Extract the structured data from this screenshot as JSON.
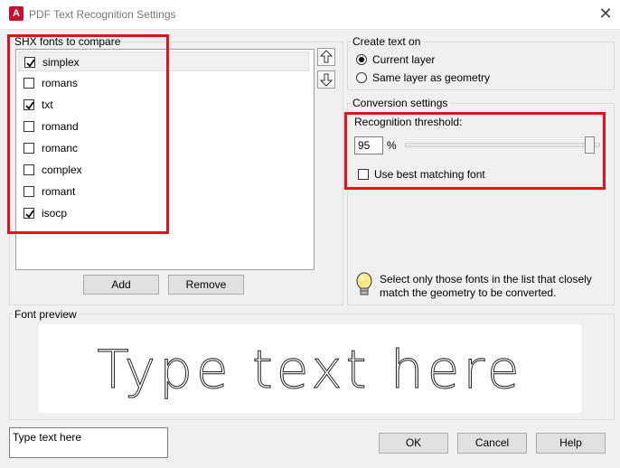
{
  "window": {
    "title": "PDF Text Recognition Settings",
    "app_icon_letter": "A",
    "close_glyph": "✕"
  },
  "shx_group": {
    "label": "SHX fonts to compare",
    "fonts": [
      {
        "name": "simplex",
        "checked": true
      },
      {
        "name": "romans",
        "checked": false
      },
      {
        "name": "txt",
        "checked": true
      },
      {
        "name": "romand",
        "checked": false
      },
      {
        "name": "romanc",
        "checked": false
      },
      {
        "name": "complex",
        "checked": false
      },
      {
        "name": "romant",
        "checked": false
      },
      {
        "name": "isocp",
        "checked": true
      }
    ],
    "add_label": "Add",
    "remove_label": "Remove"
  },
  "create_text": {
    "label": "Create text on",
    "options": [
      "Current layer",
      "Same layer as geometry"
    ],
    "selected": "Current layer"
  },
  "conversion": {
    "label": "Conversion settings",
    "threshold_label": "Recognition threshold:",
    "threshold_value": "95",
    "threshold_unit": "%",
    "best_match_label": "Use best matching font",
    "best_match_checked": false,
    "tip_line1": "Select only those fonts in the list that closely",
    "tip_line2": "match the geometry to be converted."
  },
  "preview": {
    "label": "Font preview",
    "sample_text": "Type text here"
  },
  "footer": {
    "preview_input_value": "Type text here",
    "ok_label": "OK",
    "cancel_label": "Cancel",
    "help_label": "Help"
  },
  "colors": {
    "highlight_box": "#e0141a",
    "app_icon": "#c8102e"
  }
}
